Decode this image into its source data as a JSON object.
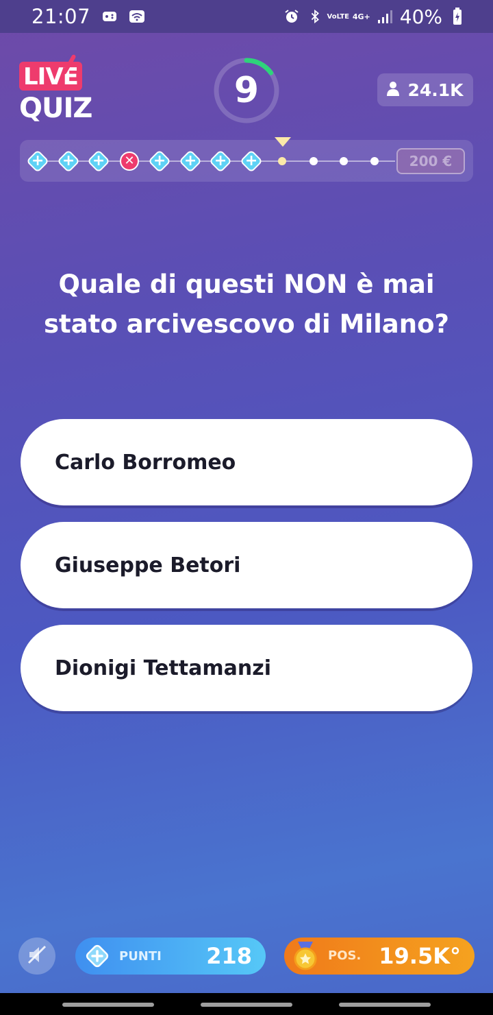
{
  "status_bar": {
    "time": "21:07",
    "battery": "40%",
    "icons": [
      "gamepad-icon",
      "wifi-icon",
      "alarm-icon",
      "bluetooth-icon",
      "volte-icon",
      "4g-icon",
      "signal-icon",
      "battery-charging-icon"
    ],
    "volte_label": "VoLTE",
    "network_label": "4G+"
  },
  "header": {
    "logo_live": "LIVE",
    "logo_quiz": "QUIZ",
    "timer_value": "9",
    "timer_progress": 0.15,
    "viewers": "24.1K"
  },
  "progress": {
    "steps": [
      "correct",
      "correct",
      "correct",
      "wrong",
      "correct",
      "correct",
      "correct",
      "correct",
      "current",
      "pending",
      "pending",
      "pending"
    ],
    "prize": "200 €"
  },
  "question": {
    "text": "Quale di questi NON è mai stato arcivescovo di Milano?"
  },
  "answers": [
    {
      "label": "Carlo Borromeo"
    },
    {
      "label": "Giuseppe Betori"
    },
    {
      "label": "Dionigi Tettamanzi"
    }
  ],
  "footer": {
    "points_label": "PUNTI",
    "points_value": "218",
    "position_label": "POS.",
    "position_value": "19.5K°"
  },
  "colors": {
    "accent_pink": "#ee3b6d",
    "correct_blue": "#5ed2f5",
    "timer_green": "#2ed47a",
    "points_blue": "#3f8ff0",
    "position_orange": "#f07a1a"
  }
}
